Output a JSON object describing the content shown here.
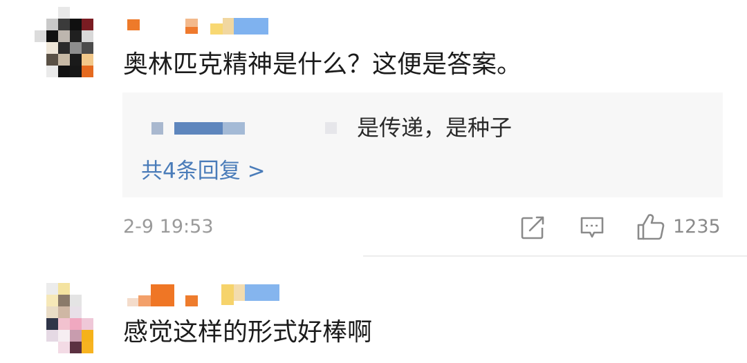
{
  "comments": [
    {
      "text": "奥林匹克精神是什么？这便是答案。",
      "reply_preview": {
        "text": "是传递，是种子"
      },
      "reply_count_label": "共4条回复 >",
      "time": "2-9 19:53",
      "like_count": "1235",
      "icons": [
        "share-icon",
        "comment-icon",
        "like-icon"
      ]
    },
    {
      "text": "感觉这样的形式好棒啊"
    }
  ],
  "colors": {
    "link": "#4a7cb9",
    "meta": "#9a9a9a",
    "reply_bg": "#f7f7f7"
  }
}
